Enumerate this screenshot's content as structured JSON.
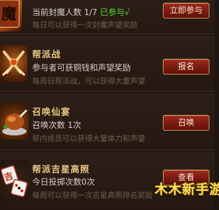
{
  "activities": [
    {
      "id": "seal-demon",
      "title": "",
      "icon": "demon-seal-icon",
      "info_prefix": "当前封魔人数 1/7",
      "info_status": "已参与√",
      "desc": "每日可以获得一次封魔声望奖励",
      "button": "立即参与"
    },
    {
      "id": "guild-war",
      "title": "帮派战",
      "icon": "crossed-swords-icon",
      "info": "参与者可获铜钱和声望奖励",
      "desc": "每周日帮派战，可以获得大量声望",
      "button": "报名"
    },
    {
      "id": "summon-feast",
      "title": "召唤仙宴",
      "icon": "roast-feast-icon",
      "info": "召唤次数 1次",
      "desc": "帮内成员可以获得大量体力和声望",
      "button": "召唤"
    },
    {
      "id": "lucky-star",
      "title": "帮派吉星高照",
      "icon": "mahjong-dice-icon",
      "info": "今日投掷次数0次",
      "desc": "每周可以获得一次吉星高照排名奖励",
      "button": "查看"
    }
  ],
  "watermark": "木木新手游",
  "colors": {
    "title": "#e9c884",
    "status_green": "#58d83b",
    "button_red": "#7a1a11",
    "button_border": "#c89b63"
  }
}
